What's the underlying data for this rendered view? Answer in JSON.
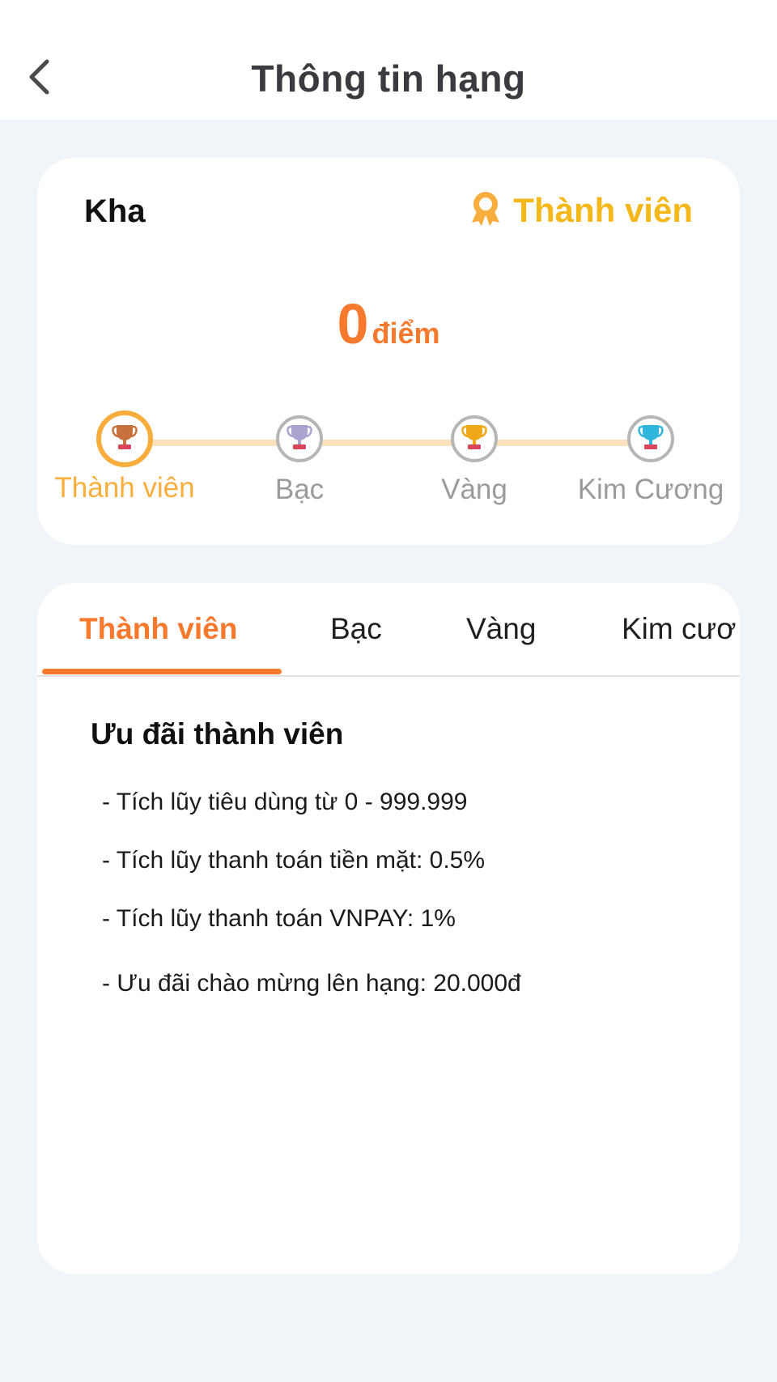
{
  "header": {
    "title": "Thông tin hạng"
  },
  "icons": {
    "back": "chevron-left-icon",
    "badge": "medal-ribbon-icon",
    "tier_trophy": "trophy-icon"
  },
  "colors": {
    "accent_orange": "#f7792d",
    "badge_yellow": "#f5b81b",
    "progress_track": "#fde1bd",
    "active_tier_ring": "#f8ad3d",
    "inactive_gray": "#9b9b9b",
    "status_red": "#f23a3a"
  },
  "profile": {
    "name": "Kha",
    "current_tier": "Thành viên",
    "points": "0",
    "points_unit": "điểm"
  },
  "tiers": [
    {
      "label": "Thành viên",
      "trophy_color": "#c9713c",
      "active": true
    },
    {
      "label": "Bạc",
      "trophy_color": "#a9a4cf",
      "active": false
    },
    {
      "label": "Vàng",
      "trophy_color": "#f0a818",
      "active": false
    },
    {
      "label": "Kim Cương",
      "trophy_color": "#2fb6dc",
      "active": false
    }
  ],
  "tabs": [
    {
      "label": "Thành viên",
      "active": true
    },
    {
      "label": "Bạc",
      "active": false
    },
    {
      "label": "Vàng",
      "active": false
    },
    {
      "label": "Kim cươ",
      "active": false
    }
  ],
  "benefits": {
    "title": "Ưu đãi thành viên",
    "items": [
      "- Tích lũy tiêu dùng từ 0 - 999.999",
      "- Tích lũy thanh toán tiền mặt: 0.5%",
      "- Tích lũy thanh toán VNPAY: 1%",
      "- Ưu đãi chào mừng lên hạng: 20.000đ"
    ]
  }
}
